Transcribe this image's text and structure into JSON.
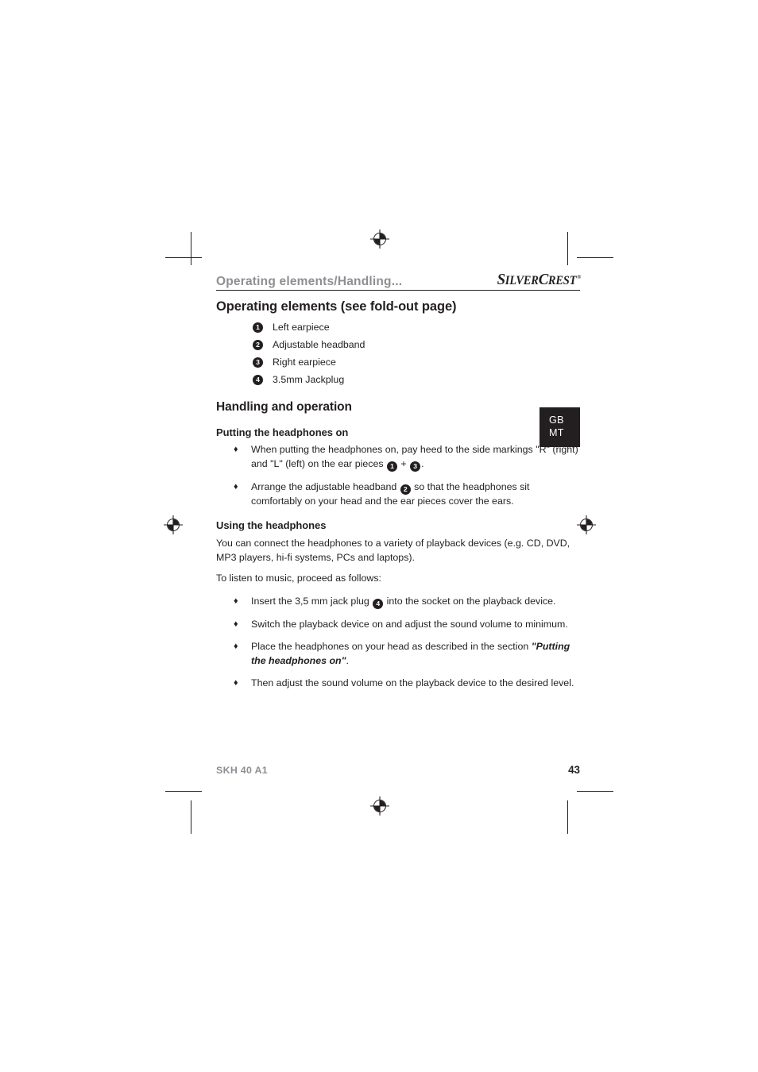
{
  "document": {
    "running_header": "Operating elements/Handling...",
    "brand": {
      "part1_cap": "S",
      "part1_rest": "ILVER",
      "part2_cap": "C",
      "part2_rest": "REST",
      "registered": "®"
    },
    "country_tab": {
      "line1": "GB",
      "line2": "MT"
    },
    "footer": {
      "model": "SKH 40 A1",
      "page_number": "43"
    }
  },
  "sections": {
    "operating_elements": {
      "heading": "Operating elements (see fold-out page)",
      "items": [
        {
          "number": "1",
          "label": "Left earpiece"
        },
        {
          "number": "2",
          "label": "Adjustable headband"
        },
        {
          "number": "3",
          "label": "Right earpiece"
        },
        {
          "number": "4",
          "label": "3.5mm Jackplug"
        }
      ]
    },
    "handling": {
      "heading": "Handling and operation",
      "putting_on": {
        "heading": "Putting the headphones on",
        "bullets": [
          {
            "glyph": "♦",
            "text_before": "When putting the headphones on, pay heed to the side markings \"R\" (right) and \"L\" (left) on the ear pieces ",
            "badge_a": "1",
            "text_middle": " + ",
            "badge_b": "3",
            "text_after": "."
          },
          {
            "glyph": "♦",
            "text_before": "Arrange the adjustable headband ",
            "badge_a": "2",
            "text_after": " so that the headphones sit comfortably on your head and the ear pieces cover the ears."
          }
        ]
      },
      "using": {
        "heading": "Using the headphones",
        "intro_paragraph": "You can connect the headphones to a variety of playback devices (e.g. CD, DVD, MP3 players, hi-fi systems, PCs and laptops).",
        "lead_in": "To listen to music, proceed as follows:",
        "bullets": [
          {
            "glyph": "♦",
            "text_before": "Insert the 3,5 mm jack plug ",
            "badge_a": "4",
            "text_after": " into the socket on the playback device."
          },
          {
            "glyph": "♦",
            "text_before": "Switch the playback device on and adjust the sound volume to minimum."
          },
          {
            "glyph": "♦",
            "text_before": "Place the headphones on your head as described in the section ",
            "emphasis": "\"Putting the headphones on\"",
            "text_after": "."
          },
          {
            "glyph": "♦",
            "text_before": "Then adjust the sound volume on the playback device to the desired level."
          }
        ]
      }
    }
  },
  "printer_marks": {
    "registration_glyph": "registration-target"
  },
  "colors": {
    "ink": "#231f20",
    "muted": "#8e8e93",
    "tab_background": "#231f20",
    "tab_text": "#ffffff"
  }
}
